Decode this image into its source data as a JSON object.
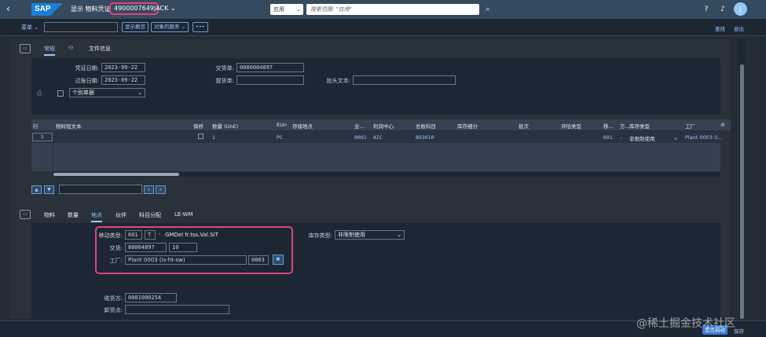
{
  "shell": {
    "back_glyph": "‹",
    "logo": "SAP",
    "title": "显示 物料凭证",
    "doc_number": "4900007649",
    "user": "JACK ⌄",
    "scope": "应用",
    "search_placeholder": "搜索范围: \"应用\"",
    "avatar_initial": "J",
    "icons": [
      "search-icon",
      "help-icon",
      "notification-icon"
    ]
  },
  "toolbar": {
    "menu_label": "菜单 ⌄",
    "btn_overview": "显示概览",
    "btn_services": "对象的服务 ⌄",
    "btn_more": "•••",
    "find": "查找",
    "exit": "退出"
  },
  "header_tabs": {
    "tab1": "常规",
    "tab2": "文件信息"
  },
  "header_fields": {
    "doc_date_label": "凭证日期:",
    "doc_date": "2023-09-22",
    "post_date_label": "过账日期:",
    "post_date": "2023-09-22",
    "delivery_label": "交货单:",
    "delivery": "0080004897",
    "bol_label": "提货单:",
    "bol": "",
    "header_text_label": "抬头文本:",
    "header_text": "",
    "slip_select": "个别单据"
  },
  "grid": {
    "headers": [
      "行",
      "物料短文本",
      "保修",
      "数量 (UnE)",
      "EUn",
      "存储地点",
      "业...",
      "利润中心",
      "总账科目",
      "库存细分",
      "批次",
      "评估类型",
      "移...",
      "方...",
      "库存类型",
      "工厂"
    ],
    "row": {
      "line": "1",
      "qty": "1",
      "eun": "PC",
      "seg": "0001",
      "profit_center": "AIC",
      "gl": "893010",
      "mvt": "601",
      "dash": "-",
      "stock_type": "非限制使用",
      "plant": "Plant 0003 (I..."
    }
  },
  "detail_tabs": [
    "物料",
    "数量",
    "地点",
    "伙伴",
    "科目分配",
    "LE-WM"
  ],
  "detail": {
    "mvt_label": "移动类型:",
    "mvt": "601",
    "mvt_ind": "T",
    "mvt_dash": "-",
    "mvt_text": "GMDel fr.tss.Val.SiT",
    "delivery_label": "交货:",
    "delivery": "80004897",
    "delivery_item": "10",
    "plant_label": "工厂:",
    "plant": "Plant 0003 (is-ht-sw)",
    "plant_code": "0003",
    "stock_type_label": "库存类型:",
    "stock_type": "非限制使用",
    "receiver_label": "收货方:",
    "receiver": "0001000254",
    "unload_label": "卸货点:"
  },
  "footer": {
    "save": "是否启动",
    "cancel": "保存"
  },
  "watermark": "@稀土掘金技术社区",
  "colors": {
    "shell": "#354a5f",
    "accent": "#9ac8ff",
    "highlight": "#e0457b"
  }
}
